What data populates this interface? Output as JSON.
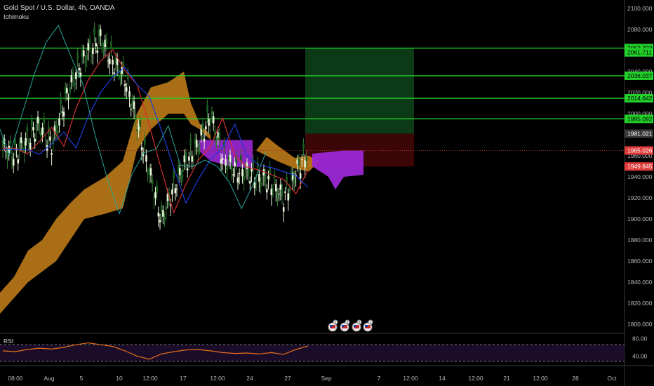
{
  "header": {
    "symbol": "Gold Spot / U.S. Dollar, 4h, OANDA",
    "indicator": "Ichimoku",
    "rsi_label": "RSI"
  },
  "colors": {
    "background": "#000000",
    "level_line": "#22d12a",
    "cloud_bullish": "#c8811a",
    "cloud_bearish": "#9c27d6",
    "target_zone": "#0d3a16",
    "stop_zone": "#3d0606",
    "price_tag_current": "#e03b3b",
    "rsi_line": "#e8701a",
    "rsi_band": "#1b0c2a"
  },
  "chart_data": [
    {
      "type": "line",
      "title": "Gold Spot / U.S. Dollar, 4h, OANDA",
      "y_axis_ticks": [
        2100,
        2080,
        2060,
        2040,
        2020,
        2000,
        1980,
        1960,
        1940,
        1920,
        1900,
        1880,
        1860,
        1840,
        1820,
        1800
      ],
      "y_tick_labels": [
        "2100.000",
        "2080.000",
        "2060.000",
        "2040.000",
        "2020.000",
        "2000.000",
        "1980.000",
        "1960.000",
        "1940.000",
        "1920.000",
        "1900.000",
        "1880.000",
        "1860.000",
        "1840.000",
        "1820.000",
        "1800.000"
      ],
      "ylim": [
        1792,
        2108
      ],
      "x_tick_labels": [
        "08:00",
        "Aug",
        "5",
        "10",
        "12:00",
        "17",
        "12:00",
        "24",
        "27",
        "Sep",
        "7",
        "12:00",
        "14",
        "12:00",
        "21",
        "12:00",
        "28",
        "Oct"
      ],
      "horizontal_levels": [
        2062.323,
        2036.037,
        2014.642,
        1995.092
      ],
      "price_tags": [
        {
          "label": "2062.323",
          "value": 2062.323,
          "kind": "level"
        },
        {
          "label": "2061.711",
          "value": 2058.2,
          "kind": "level"
        },
        {
          "label": "2036.037",
          "value": 2036.037,
          "kind": "level"
        },
        {
          "label": "2014.642",
          "value": 2014.642,
          "kind": "level"
        },
        {
          "label": "1995.092",
          "value": 1995.092,
          "kind": "level"
        },
        {
          "label": "1981.021",
          "value": 1981.021,
          "kind": "gray"
        },
        {
          "label": "1965.026",
          "value": 1965.026,
          "kind": "current"
        },
        {
          "label": "1949.845",
          "value": 1949.845,
          "kind": "current"
        }
      ],
      "position": {
        "entry": 1981.021,
        "target": 2062.323,
        "stop": 1949.845,
        "start_x": "Aug 28",
        "end_x": "Sep 8"
      },
      "current_price": 1965.026,
      "series": [
        {
          "name": "",
          "x": [
            0,
            4,
            8,
            12,
            16,
            20,
            24,
            28,
            32,
            36,
            40,
            44,
            48,
            52,
            56,
            60,
            64,
            68,
            72,
            76,
            80,
            84,
            88,
            92,
            96,
            100
          ],
          "values": [
            1968,
            1962,
            1975,
            1990,
            1970,
            2010,
            2040,
            2060,
            2072,
            2050,
            2035,
            1992,
            1945,
            1900,
            1930,
            1955,
            1970,
            2000,
            1960,
            1948,
            1945,
            1940,
            1935,
            1920,
            1945,
            1965
          ]
        }
      ]
    },
    {
      "type": "line",
      "title": "RSI",
      "y_tick_labels": [
        "80.00",
        "40.00"
      ],
      "ylim": [
        20,
        90
      ],
      "band": [
        30,
        70
      ],
      "series": [
        {
          "name": "",
          "x": [
            0,
            4,
            8,
            12,
            16,
            20,
            24,
            28,
            32,
            36,
            40,
            44,
            48,
            52,
            56,
            60,
            64,
            68,
            72,
            76,
            80,
            84,
            88,
            92,
            96,
            100
          ],
          "values": [
            52,
            50,
            55,
            58,
            56,
            60,
            66,
            70,
            66,
            62,
            52,
            40,
            33,
            45,
            50,
            54,
            55,
            52,
            48,
            46,
            47,
            45,
            48,
            44,
            55,
            63
          ]
        }
      ]
    }
  ],
  "events": {
    "icons": [
      "flag-us-icon",
      "flag-us-icon",
      "flag-us-icon",
      "flag-us-icon"
    ],
    "counts": [
      "2",
      "3",
      "5",
      "1"
    ]
  }
}
